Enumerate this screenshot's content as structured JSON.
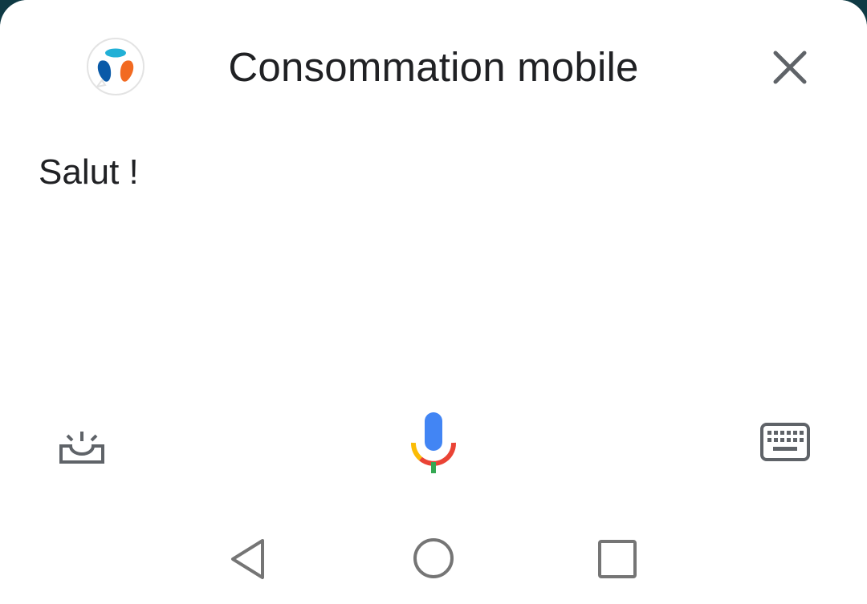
{
  "header": {
    "title": "Consommation mobile",
    "logo_icon": "bouygues-telecom-logo-icon",
    "close_icon": "close-icon"
  },
  "conversation": {
    "message": "Salut !"
  },
  "controls": {
    "left_icon": "inbox-icon",
    "center_icon": "microphone-icon",
    "right_icon": "keyboard-icon"
  },
  "navbar": {
    "back_icon": "back-triangle-icon",
    "home_icon": "home-circle-icon",
    "recents_icon": "recents-square-icon"
  },
  "colors": {
    "mic_blue": "#4285F4",
    "mic_red": "#EA4335",
    "mic_yellow": "#FBBC05",
    "mic_green": "#34A853",
    "logo_blue": "#0a5aa8",
    "logo_orange": "#f26a21",
    "logo_cyan": "#21b0d6",
    "icon_gray": "#5f6368"
  }
}
